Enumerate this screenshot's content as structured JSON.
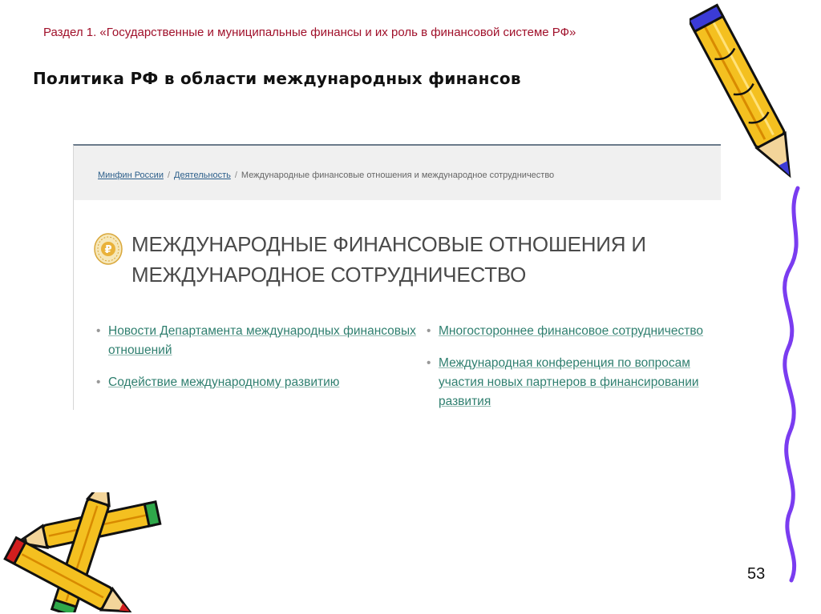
{
  "section_title": "Раздел 1. «Государственные и муниципальные финансы и их роль в финансовой системе РФ»",
  "slide_heading": "Политика РФ в области международных финансов",
  "breadcrumb": {
    "items": [
      "Минфин России",
      "Деятельность",
      "Международные финансовые отношения и международное сотрудничество"
    ],
    "separator": "/"
  },
  "page_heading": {
    "line1": "МЕЖДУНАРОДНЫЕ ФИНАНСОВЫЕ ОТНОШЕНИЯ И",
    "line2": "МЕЖДУНАРОДНОЕ СОТРУДНИЧЕСТВО"
  },
  "links_left": [
    "Новости Департамента международных финансовых отношений",
    "Содействие международному развитию"
  ],
  "links_right": [
    "Многостороннее финансовое сотрудничество",
    "Международная конференция по вопросам участия новых партнеров в финансировании развития"
  ],
  "page_number": "53",
  "emblem_symbol": "₽",
  "colors": {
    "section_title": "#a0102a",
    "link": "#2f7f6f",
    "pencil_body": "#f4c020",
    "squiggle": "#7a3cf0"
  },
  "icons": {
    "emblem": "ruble-emblem-icon",
    "pencils": "pencil-icon",
    "squiggle": "squiggle-line-decoration"
  }
}
